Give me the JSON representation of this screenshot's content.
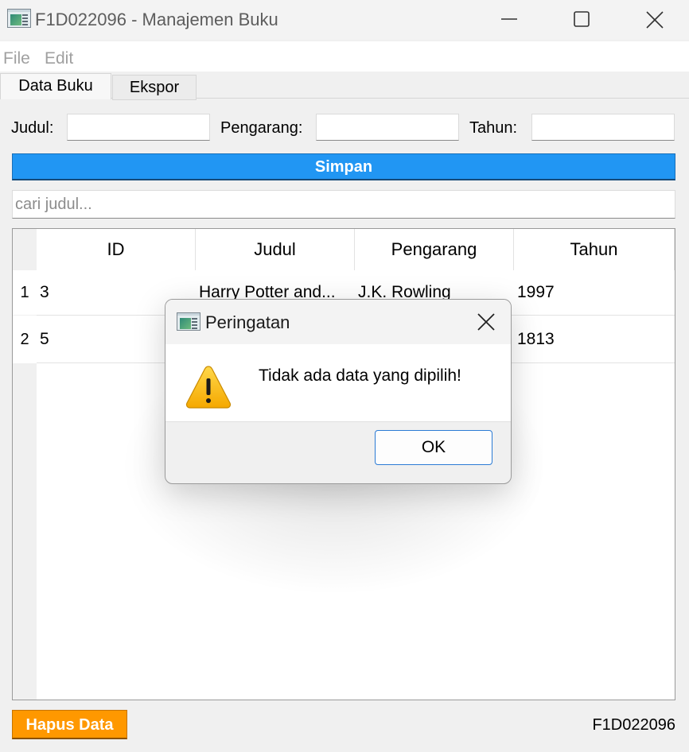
{
  "window": {
    "title": "F1D022096 - Manajemen Buku",
    "icon": "app-window-icon",
    "controls": [
      "minimize-icon",
      "maximize-icon",
      "close-icon"
    ]
  },
  "menu": {
    "items": [
      "File",
      "Edit"
    ]
  },
  "tabs": [
    {
      "label": "Data Buku",
      "active": true
    },
    {
      "label": "Ekspor",
      "active": false
    }
  ],
  "form": {
    "judul_label": "Judul:",
    "judul_value": "",
    "pengarang_label": "Pengarang:",
    "pengarang_value": "",
    "tahun_label": "Tahun:",
    "tahun_value": "",
    "save_label": "Simpan",
    "save_color": "#2196f3"
  },
  "search": {
    "placeholder": "cari judul...",
    "value": ""
  },
  "table": {
    "columns": [
      "ID",
      "Judul",
      "Pengarang",
      "Tahun"
    ],
    "row_headers": [
      "1",
      "2"
    ],
    "rows": [
      [
        "3",
        "Harry Potter and...",
        "J.K. Rowling",
        "1997"
      ],
      [
        "5",
        "",
        "",
        "1813"
      ]
    ]
  },
  "footer": {
    "delete_label": "Hapus Data",
    "delete_color": "#ff9800",
    "student_id": "F1D022096"
  },
  "dialog": {
    "title": "Peringatan",
    "icon": "warning-icon",
    "message": "Tidak ada data yang dipilih!",
    "ok_label": "OK"
  }
}
